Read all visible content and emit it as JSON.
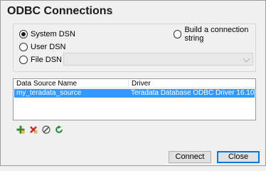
{
  "dialog": {
    "title": "ODBC Connections"
  },
  "options": {
    "system_dsn": "System DSN",
    "user_dsn": "User DSN",
    "file_dsn": "File DSN",
    "build_connection": "Build a connection string",
    "selected": "System DSN",
    "file_dsn_value": ""
  },
  "table": {
    "headers": [
      "Data Source Name",
      "Driver"
    ],
    "rows": [
      {
        "name": "my_teradata_source",
        "driver": "Teradata Database ODBC Driver 16.10",
        "selected": true
      }
    ]
  },
  "toolbar": {
    "icons": [
      "add-icon",
      "delete-icon",
      "edit-icon",
      "refresh-icon"
    ]
  },
  "buttons": {
    "connect": "Connect",
    "close": "Close"
  },
  "colors": {
    "selection": "#3399ff",
    "add": "#2e8b2e",
    "delete": "#c03030",
    "refresh": "#1d8a2e"
  }
}
